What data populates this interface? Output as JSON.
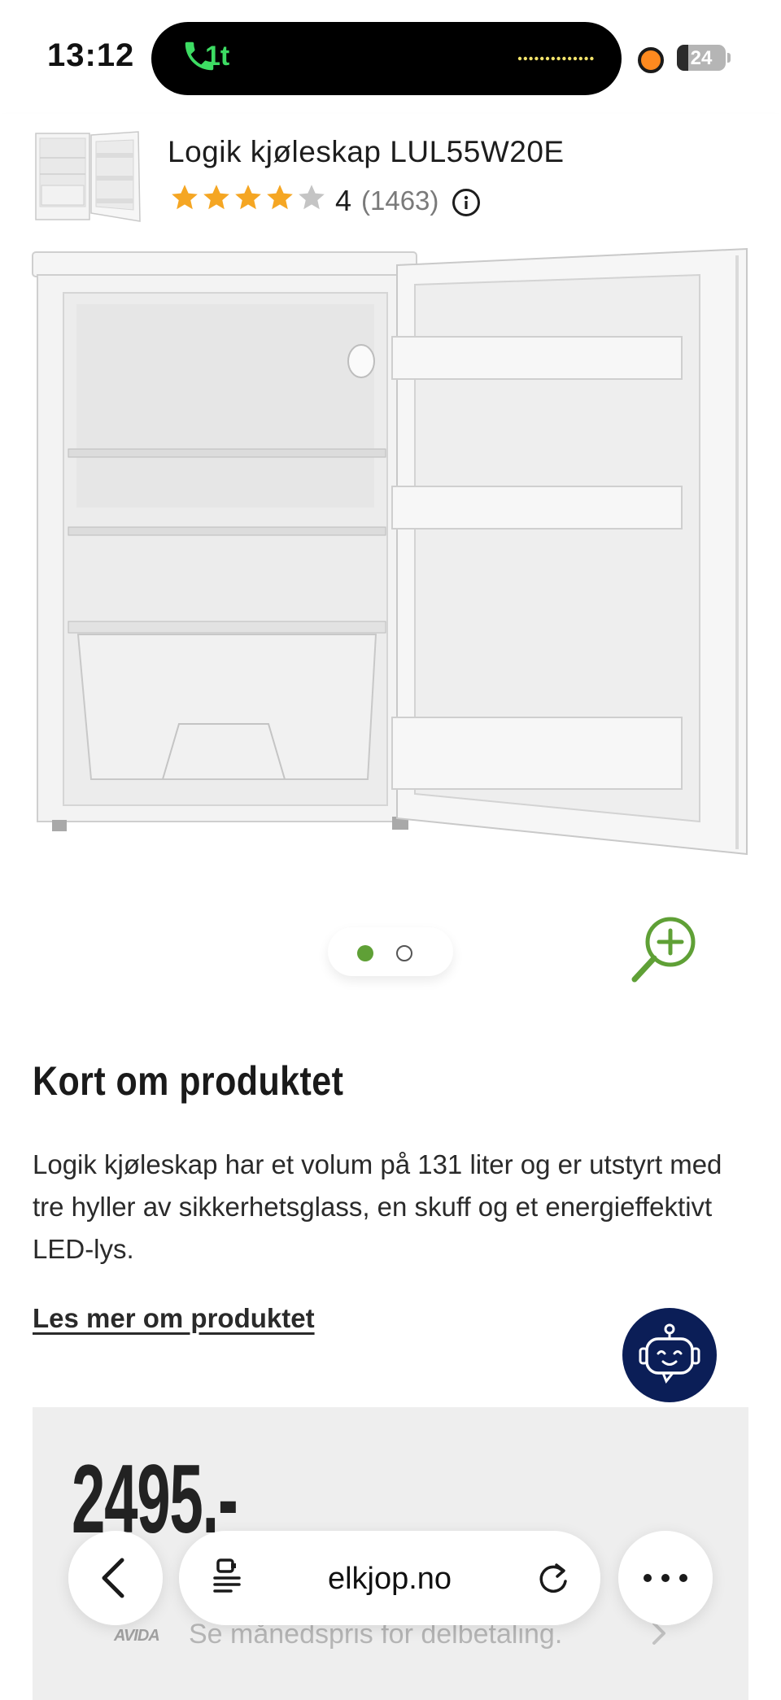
{
  "status_bar": {
    "time": "13:12",
    "call_label": "1t",
    "battery_level": "24",
    "battery_fraction": 0.24
  },
  "header": {
    "product_title": "Logik kjøleskap LUL55W20E",
    "rating_value": "4",
    "rating_count": "(1463)",
    "stars_filled": 4,
    "stars_total": 5,
    "star_color": "#f5a623"
  },
  "gallery": {
    "image_count": 2,
    "active_index": 0,
    "active_dot_color": "#5fa036",
    "zoom_icon": "zoom-in-icon"
  },
  "description": {
    "heading": "Kort om produktet",
    "text": "Logik kjøleskap har et volum på 131 liter og er utstyrt med tre hyller av sikkerhetsglass, en skuff og et energieffektivt LED-lys.",
    "read_more": "Les mer om produktet"
  },
  "chat": {
    "icon": "chatbot-icon",
    "color": "#0b1e57"
  },
  "price": {
    "amount": "2495.-",
    "installment_provider": "AVIDA",
    "installment_text": "Se månedspris for delbetaling."
  },
  "browser_toolbar": {
    "url": "elkjop.no",
    "back_icon": "back-chevron-icon",
    "reader_icon": "page-menu-icon",
    "reload_icon": "reload-icon",
    "more_icon": "more-dots-icon"
  }
}
